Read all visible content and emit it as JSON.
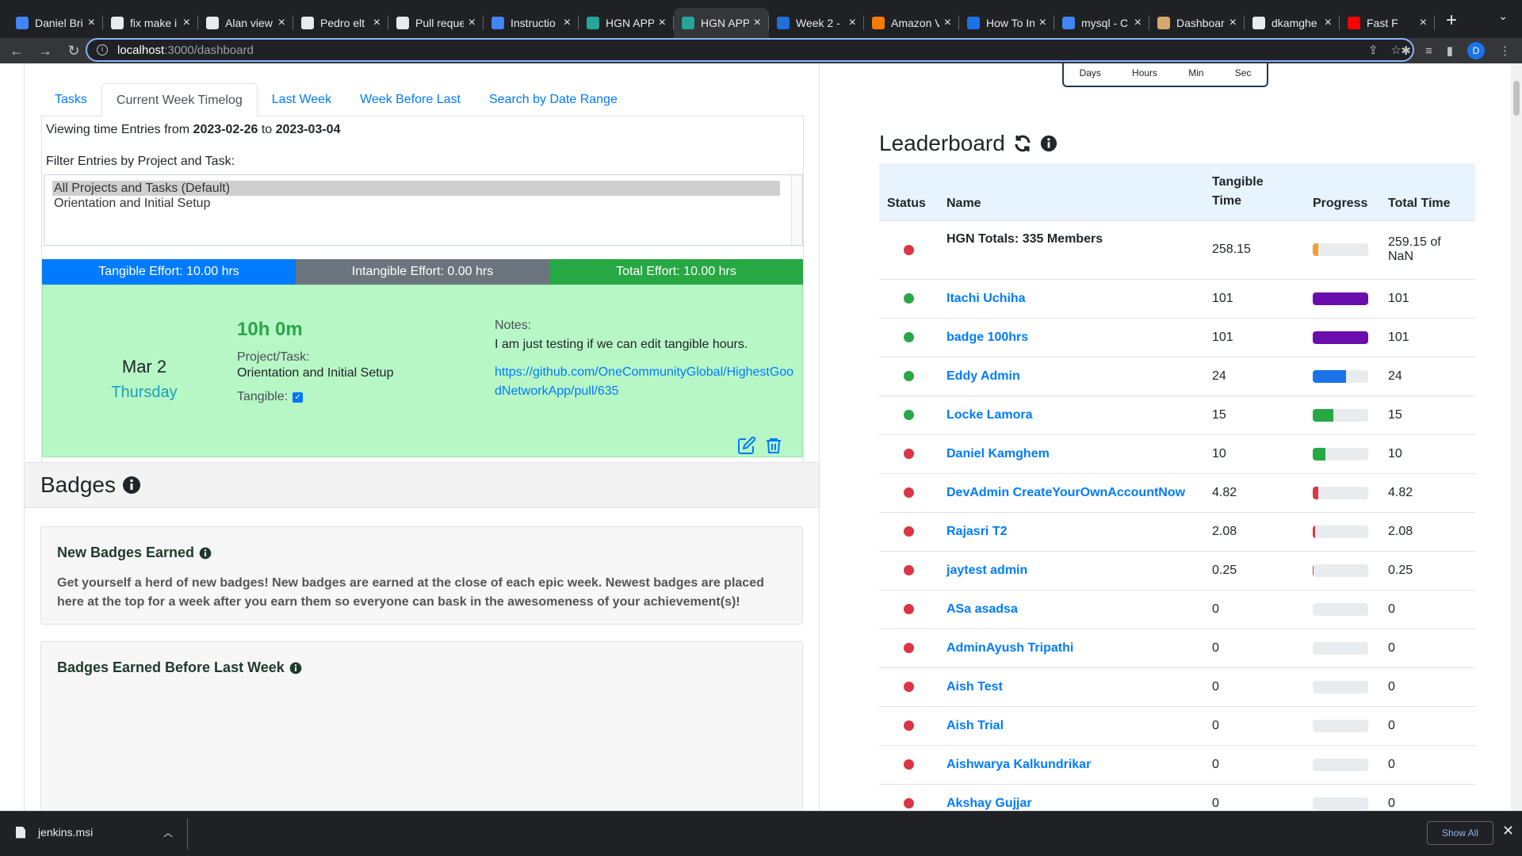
{
  "browser": {
    "tabs": [
      {
        "title": "Daniel Bri",
        "color": "#4285f4"
      },
      {
        "title": "fix make i",
        "color": "#e8eaed"
      },
      {
        "title": "Alan view",
        "color": "#e8eaed"
      },
      {
        "title": "Pedro elt",
        "color": "#e8eaed"
      },
      {
        "title": "Pull reque",
        "color": "#e8eaed"
      },
      {
        "title": "Instructio",
        "color": "#4285f4"
      },
      {
        "title": "HGN APP",
        "color": "#26a69a"
      },
      {
        "title": "HGN APP",
        "color": "#26a69a",
        "active": true
      },
      {
        "title": "Week 2 -",
        "color": "#1e6fd9"
      },
      {
        "title": "Amazon V",
        "color": "#f57c00"
      },
      {
        "title": "How To In",
        "color": "#1a73e8"
      },
      {
        "title": "mysql - C",
        "color": "#4285f4"
      },
      {
        "title": "Dashboar",
        "color": "#d7a86e"
      },
      {
        "title": "dkamghe",
        "color": "#e8eaed"
      },
      {
        "title": "Fast F",
        "color": "#ff0000"
      }
    ],
    "url_host": "localhost",
    "url_path": ":3000/dashboard",
    "profile_initial": "D"
  },
  "countdown": {
    "labels": [
      "Days",
      "Hours",
      "Min",
      "Sec"
    ]
  },
  "timelog": {
    "tabs": [
      "Tasks",
      "Current Week Timelog",
      "Last Week",
      "Week Before Last",
      "Search by Date Range"
    ],
    "active_tab": 1,
    "viewing_prefix": "Viewing time Entries from ",
    "from_date": "2023-02-26",
    "viewing_mid": " to ",
    "to_date": "2023-03-04",
    "filter_label": "Filter Entries by Project and Task:",
    "filter_options": [
      "All Projects and Tasks (Default)",
      "Orientation and Initial Setup"
    ],
    "tangible_effort": "Tangible Effort: 10.00 hrs",
    "intangible_effort": "Intangible Effort: 0.00 hrs",
    "total_effort": "Total Effort: 10.00 hrs",
    "entry": {
      "date": "Mar 2",
      "day": "Thursday",
      "hours": "10h 0m",
      "project_label": "Project/Task:",
      "project": "Orientation and Initial Setup",
      "tangible_label": "Tangible:",
      "tangible": true,
      "notes_label": "Notes:",
      "notes": "I am just testing if we can edit tangible hours.",
      "link": "https://github.com/OneCommunityGlobal/HighestGoodNetworkApp/pull/635"
    }
  },
  "badges": {
    "title": "Badges",
    "new_title": "New Badges Earned",
    "new_text": "Get yourself a herd of new badges! New badges are earned at the close of each epic week. Newest badges are placed here at the top for a week after you earn them so everyone can bask in the awesomeness of your achievement(s)!",
    "before_title": "Badges Earned Before Last Week"
  },
  "leaderboard": {
    "title": "Leaderboard",
    "headers": {
      "status": "Status",
      "name": "Name",
      "tangible_1": "Tangible",
      "tangible_2": "Time",
      "progress": "Progress",
      "total": "Total Time"
    },
    "totals": {
      "name": "HGN Totals: 335 Members",
      "tangible": "258.15",
      "total": "259.15 of NaN",
      "status": "#dc3545",
      "progress": 0.1,
      "bar": "#f0a030"
    },
    "rows": [
      {
        "name": "Itachi Uchiha",
        "tangible": "101",
        "total": "101",
        "status": "#28a745",
        "progress": 1.0,
        "bar": "#6a0dad"
      },
      {
        "name": "badge 100hrs",
        "tangible": "101",
        "total": "101",
        "status": "#28a745",
        "progress": 1.0,
        "bar": "#6a0dad"
      },
      {
        "name": "Eddy Admin",
        "tangible": "24",
        "total": "24",
        "status": "#28a745",
        "progress": 0.6,
        "bar": "#1a73e8"
      },
      {
        "name": "Locke Lamora",
        "tangible": "15",
        "total": "15",
        "status": "#28a745",
        "progress": 0.37,
        "bar": "#28a745"
      },
      {
        "name": "Daniel Kamghem",
        "tangible": "10",
        "total": "10",
        "status": "#dc3545",
        "progress": 0.23,
        "bar": "#28a745"
      },
      {
        "name": "DevAdmin CreateYourOwnAccountNow",
        "tangible": "4.82",
        "total": "4.82",
        "status": "#dc3545",
        "progress": 0.1,
        "bar": "#dc3545"
      },
      {
        "name": "Rajasri T2",
        "tangible": "2.08",
        "total": "2.08",
        "status": "#dc3545",
        "progress": 0.04,
        "bar": "#dc3545"
      },
      {
        "name": "jaytest admin",
        "tangible": "0.25",
        "total": "0.25",
        "status": "#dc3545",
        "progress": 0.01,
        "bar": "#dc3545"
      },
      {
        "name": "ASa asadsa",
        "tangible": "0",
        "total": "0",
        "status": "#dc3545",
        "progress": 0,
        "bar": "#dc3545"
      },
      {
        "name": "AdminAyush Tripathi",
        "tangible": "0",
        "total": "0",
        "status": "#dc3545",
        "progress": 0,
        "bar": "#dc3545"
      },
      {
        "name": "Aish Test",
        "tangible": "0",
        "total": "0",
        "status": "#dc3545",
        "progress": 0,
        "bar": "#dc3545"
      },
      {
        "name": "Aish Trial",
        "tangible": "0",
        "total": "0",
        "status": "#dc3545",
        "progress": 0,
        "bar": "#dc3545"
      },
      {
        "name": "Aishwarya Kalkundrikar",
        "tangible": "0",
        "total": "0",
        "status": "#dc3545",
        "progress": 0,
        "bar": "#dc3545"
      },
      {
        "name": "Akshay Gujjar",
        "tangible": "0",
        "total": "0",
        "status": "#dc3545",
        "progress": 0,
        "bar": "#dc3545"
      }
    ]
  },
  "downloads": {
    "file": "jenkins.msi",
    "show_all": "Show All"
  }
}
